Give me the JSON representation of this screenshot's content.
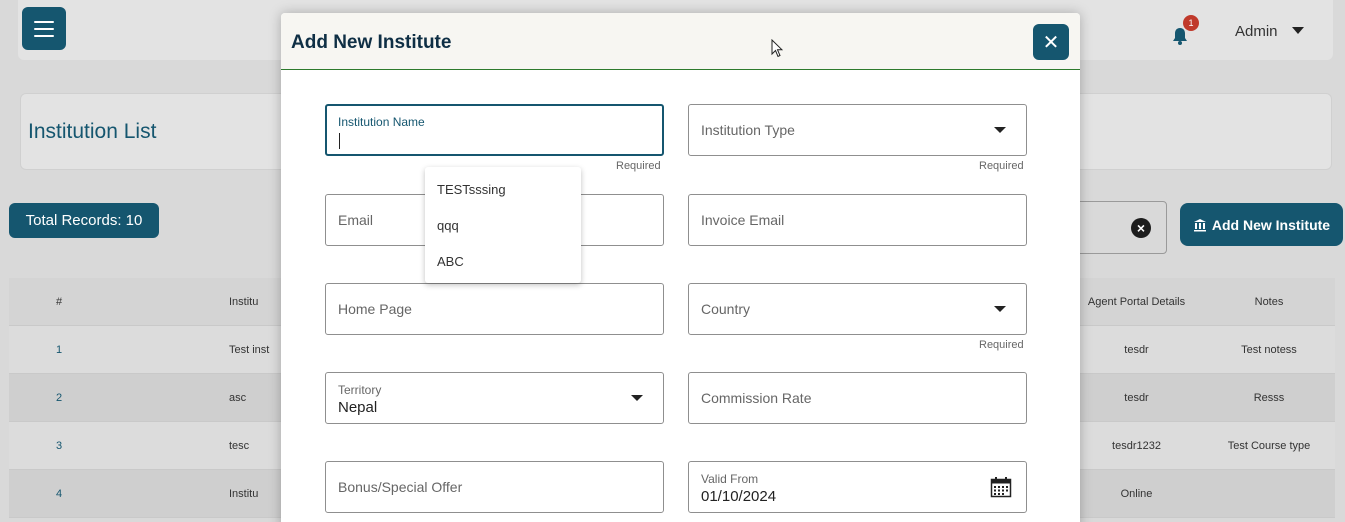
{
  "header": {
    "notification_count": "1",
    "user": "Admin"
  },
  "page": {
    "title": "Institution List",
    "total_records": "Total Records: 10",
    "add_button": "Add New Institute"
  },
  "table": {
    "headers": {
      "num": "#",
      "name": "Institu",
      "agent": "Agent Portal Details",
      "notes": "Notes"
    },
    "rows": [
      {
        "num": "1",
        "name": "Test inst",
        "agent": "tesdr",
        "notes": "Test notess"
      },
      {
        "num": "2",
        "name": "asc",
        "agent": "tesdr",
        "notes": "Resss"
      },
      {
        "num": "3",
        "name": "tesc",
        "agent": "tesdr1232",
        "notes": "Test Course type"
      },
      {
        "num": "4",
        "name": "Institu",
        "agent": "Online",
        "notes": ""
      }
    ]
  },
  "modal": {
    "title": "Add New Institute",
    "close_icon": "close-icon",
    "fields": {
      "institution_name": {
        "label": "Institution Name",
        "value": "",
        "helper": "Required"
      },
      "institution_type": {
        "placeholder": "Institution Type",
        "helper": "Required"
      },
      "email": {
        "placeholder": "Email"
      },
      "invoice_email": {
        "placeholder": "Invoice Email"
      },
      "home_page": {
        "placeholder": "Home Page"
      },
      "country": {
        "placeholder": "Country",
        "helper": "Required"
      },
      "territory": {
        "label": "Territory",
        "value": "Nepal"
      },
      "commission_rate": {
        "placeholder": "Commission Rate"
      },
      "bonus_offer": {
        "placeholder": "Bonus/Special Offer"
      },
      "valid_from": {
        "label": "Valid From",
        "value": "01/10/2024"
      }
    },
    "autocomplete": [
      "TESTsssing",
      "qqq",
      "ABC"
    ]
  },
  "colors": {
    "primary": "#15566f",
    "header_border": "#2d7a2d",
    "badge": "#c0392b"
  }
}
